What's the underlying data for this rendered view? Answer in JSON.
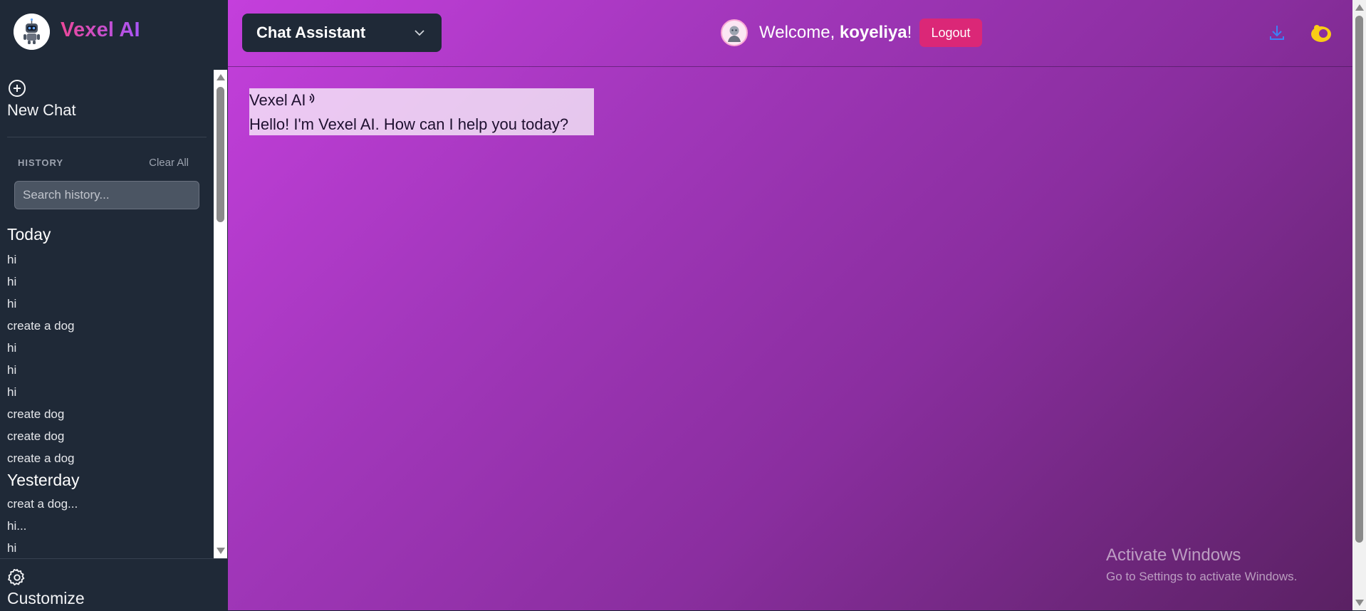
{
  "app": {
    "name": "Vexel AI"
  },
  "sidebar": {
    "new_chat_label": "New Chat",
    "new_chat_icon": "plus-circle-icon",
    "history_label": "HISTORY",
    "clear_all_label": "Clear All",
    "search_placeholder": "Search history...",
    "groups": [
      {
        "title": "Today",
        "items": [
          "hi",
          "hi",
          "hi",
          "create a dog",
          "hi",
          "hi",
          "hi",
          "create dog",
          "create dog",
          "create a dog"
        ]
      },
      {
        "title": "Yesterday",
        "items": [
          "creat a dog...",
          "hi...",
          "hi"
        ]
      }
    ],
    "customize_label": "Customize",
    "customize_icon": "gear-icon"
  },
  "header": {
    "model_select": "Chat Assistant",
    "welcome_prefix": "Welcome, ",
    "username": "koyeliya",
    "welcome_suffix": "!",
    "logout_label": "Logout",
    "download_icon": "download-icon",
    "theme_icon": "theme-toggle-icon"
  },
  "chat": {
    "messages": [
      {
        "sender": "Vexel AI",
        "text": "Hello! I'm Vexel AI. How can I help you today?"
      }
    ]
  },
  "watermark": {
    "title": "Activate Windows",
    "subtitle": "Go to Settings to activate Windows."
  },
  "colors": {
    "sidebar_bg": "#1f2937",
    "brand_gradient_start": "#ec4899",
    "brand_gradient_end": "#a855f7",
    "logout_bg": "#db2777",
    "main_gradient_start": "#c43fdc",
    "main_gradient_end": "#5a2163",
    "download_icon_color": "#3b82f6",
    "theme_icon_color": "#facc15"
  }
}
